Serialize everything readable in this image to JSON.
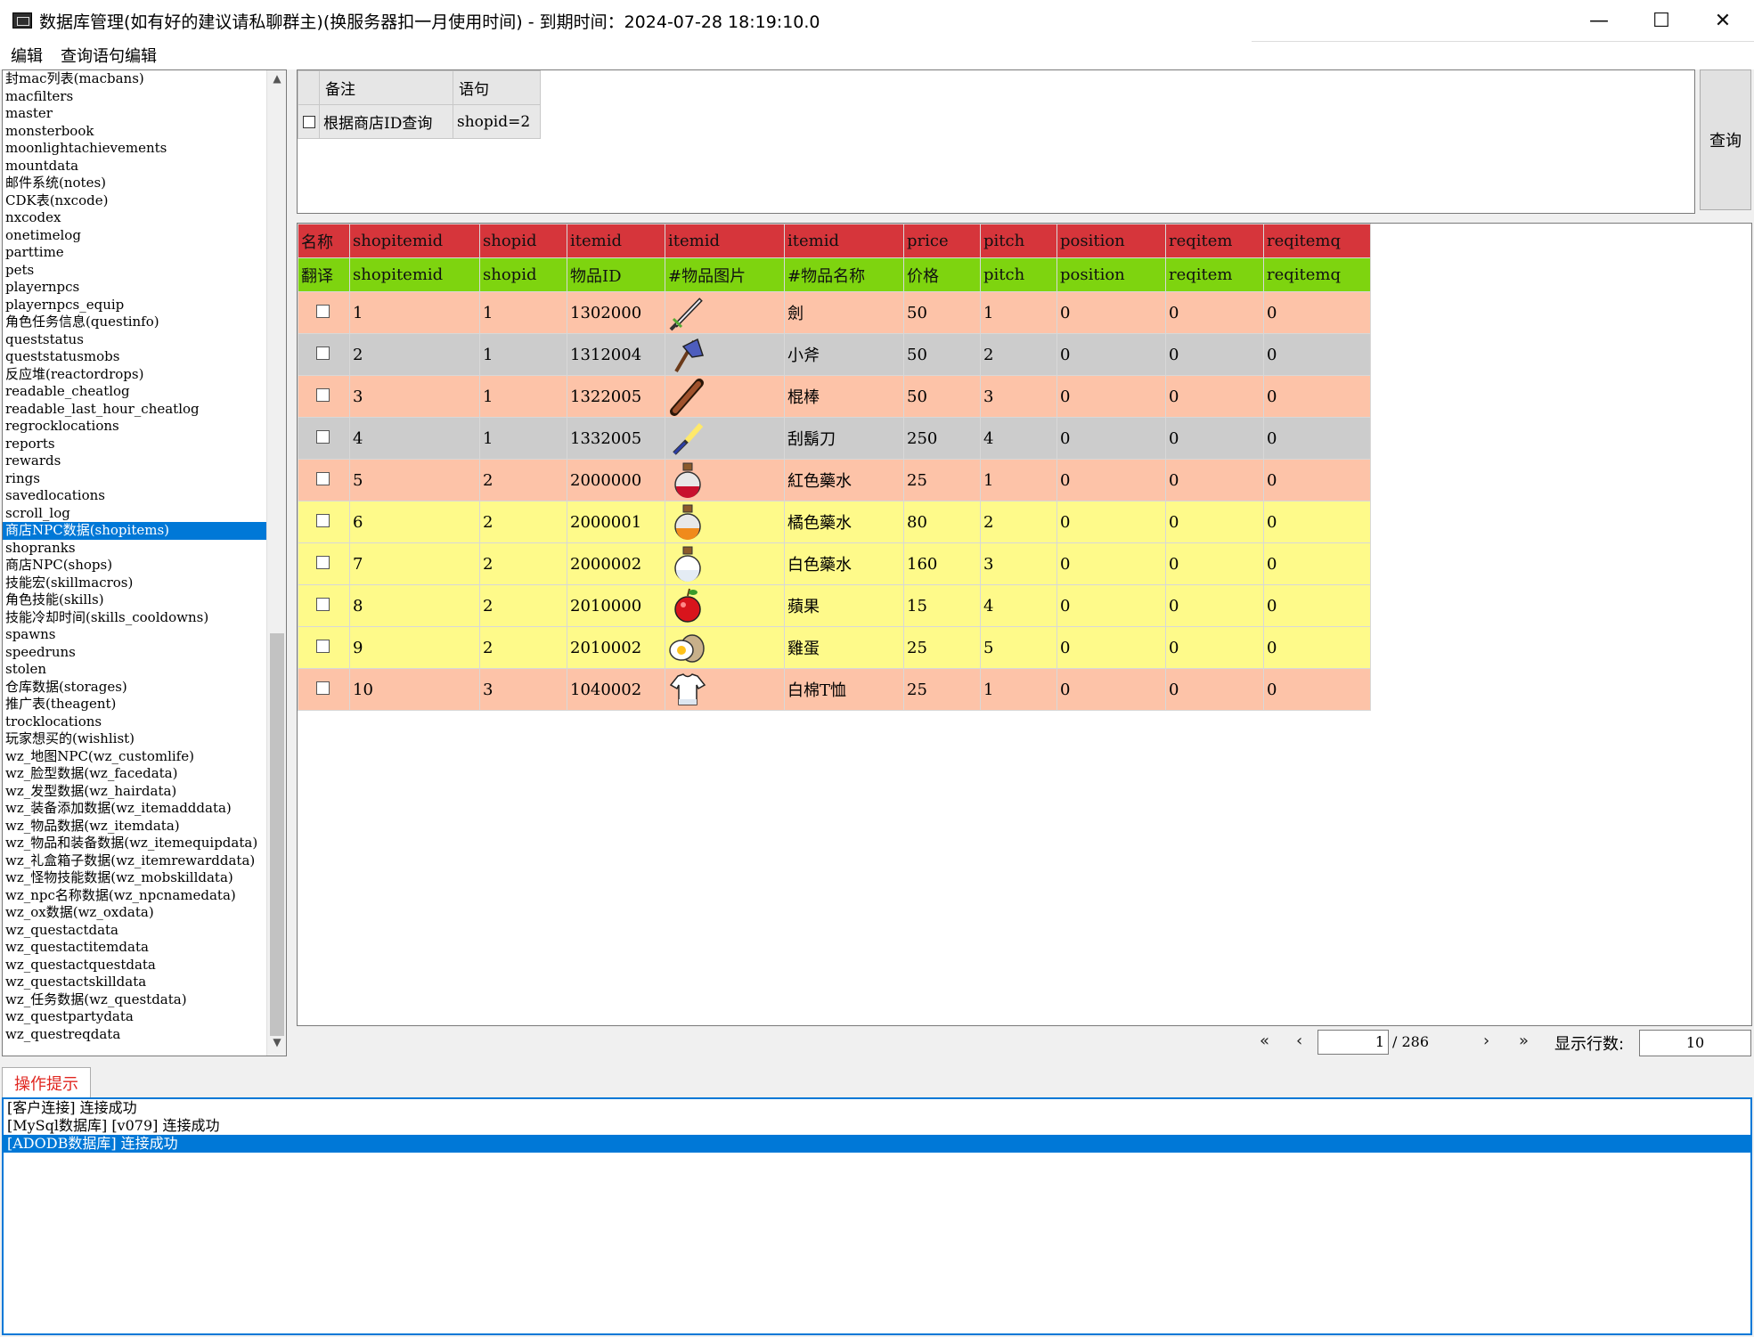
{
  "window": {
    "title": "数据库管理(如有好的建议请私聊群主)(换服务器扣一月使用时间) - 到期时间：2024-07-28 18:19:10.0",
    "minimize_glyph": "—",
    "maximize_glyph": "☐",
    "close_glyph": "✕"
  },
  "menu": [
    "编辑",
    "查询语句编辑"
  ],
  "tables": [
    "封mac列表(macbans)",
    "macfilters",
    "master",
    "monsterbook",
    "moonlightachievements",
    "mountdata",
    "邮件系统(notes)",
    "CDK表(nxcode)",
    "nxcodex",
    "onetimelog",
    "parttime",
    "pets",
    "playernpcs",
    "playernpcs_equip",
    "角色任务信息(questinfo)",
    "queststatus",
    "queststatusmobs",
    "反应堆(reactordrops)",
    "readable_cheatlog",
    "readable_last_hour_cheatlog",
    "regrocklocations",
    "reports",
    "rewards",
    "rings",
    "savedlocations",
    "scroll_log",
    "商店NPC数据(shopitems)",
    "shopranks",
    "商店NPC(shops)",
    "技能宏(skillmacros)",
    "角色技能(skills)",
    "技能冷却时间(skills_cooldowns)",
    "spawns",
    "speedruns",
    "stolen",
    "仓库数据(storages)",
    "推广表(theagent)",
    "trocklocations",
    "玩家想买的(wishlist)",
    "wz_地图NPC(wz_customlife)",
    "wz_脸型数据(wz_facedata)",
    "wz_发型数据(wz_hairdata)",
    "wz_装备添加数据(wz_itemadddata)",
    "wz_物品数据(wz_itemdata)",
    "wz_物品和装备数据(wz_itemequipdata)",
    "wz_礼盒箱子数据(wz_itemrewarddata)",
    "wz_怪物技能数据(wz_mobskilldata)",
    "wz_npc名称数据(wz_npcnamedata)",
    "wz_ox数据(wz_oxdata)",
    "wz_questactdata",
    "wz_questactitemdata",
    "wz_questactquestdata",
    "wz_questactskilldata",
    "wz_任务数据(wz_questdata)",
    "wz_questpartydata",
    "wz_questreqdata"
  ],
  "selected_table": "商店NPC数据(shopitems)",
  "query": {
    "headers": [
      "备注",
      "语句"
    ],
    "rows": [
      {
        "note": "根据商店ID查询",
        "sql": "shopid=2",
        "checked": false
      }
    ],
    "button_label": "查询"
  },
  "grid": {
    "name_row": [
      "名称",
      "shopitemid",
      "shopid",
      "itemid",
      "itemid",
      "itemid",
      "price",
      "pitch",
      "position",
      "reqitem",
      "reqitemq"
    ],
    "trans_row": [
      "翻译",
      "shopitemid",
      "shopid",
      "物品ID",
      "#物品图片",
      "#物品名称",
      "价格",
      "pitch",
      "position",
      "reqitem",
      "reqitemq"
    ],
    "rows": [
      {
        "shopitemid": "1",
        "shopid": "1",
        "itemid": "1302000",
        "icon": "sword-icon",
        "name": "劍",
        "price": "50",
        "pitch": "1",
        "position": "0",
        "reqitem": "0",
        "reqitemq": "0",
        "color": "salmon"
      },
      {
        "shopitemid": "2",
        "shopid": "1",
        "itemid": "1312004",
        "icon": "axe-icon",
        "name": "小斧",
        "price": "50",
        "pitch": "2",
        "position": "0",
        "reqitem": "0",
        "reqitemq": "0",
        "color": "gray"
      },
      {
        "shopitemid": "3",
        "shopid": "1",
        "itemid": "1322005",
        "icon": "club-icon",
        "name": "棍棒",
        "price": "50",
        "pitch": "3",
        "position": "0",
        "reqitem": "0",
        "reqitemq": "0",
        "color": "salmon"
      },
      {
        "shopitemid": "4",
        "shopid": "1",
        "itemid": "1332005",
        "icon": "razor-icon",
        "name": "刮鬍刀",
        "price": "250",
        "pitch": "4",
        "position": "0",
        "reqitem": "0",
        "reqitemq": "0",
        "color": "gray"
      },
      {
        "shopitemid": "5",
        "shopid": "2",
        "itemid": "2000000",
        "icon": "red-potion-icon",
        "name": "紅色藥水",
        "price": "25",
        "pitch": "1",
        "position": "0",
        "reqitem": "0",
        "reqitemq": "0",
        "color": "salmon"
      },
      {
        "shopitemid": "6",
        "shopid": "2",
        "itemid": "2000001",
        "icon": "orange-potion-icon",
        "name": "橘色藥水",
        "price": "80",
        "pitch": "2",
        "position": "0",
        "reqitem": "0",
        "reqitemq": "0",
        "color": "yellow"
      },
      {
        "shopitemid": "7",
        "shopid": "2",
        "itemid": "2000002",
        "icon": "white-potion-icon",
        "name": "白色藥水",
        "price": "160",
        "pitch": "3",
        "position": "0",
        "reqitem": "0",
        "reqitemq": "0",
        "color": "yellow"
      },
      {
        "shopitemid": "8",
        "shopid": "2",
        "itemid": "2010000",
        "icon": "apple-icon",
        "name": "蘋果",
        "price": "15",
        "pitch": "4",
        "position": "0",
        "reqitem": "0",
        "reqitemq": "0",
        "color": "yellow"
      },
      {
        "shopitemid": "9",
        "shopid": "2",
        "itemid": "2010002",
        "icon": "egg-icon",
        "name": "雞蛋",
        "price": "25",
        "pitch": "5",
        "position": "0",
        "reqitem": "0",
        "reqitemq": "0",
        "color": "yellow"
      },
      {
        "shopitemid": "10",
        "shopid": "3",
        "itemid": "1040002",
        "icon": "tshirt-icon",
        "name": "白棉T恤",
        "price": "25",
        "pitch": "1",
        "position": "0",
        "reqitem": "0",
        "reqitemq": "0",
        "color": "salmon"
      }
    ]
  },
  "pager": {
    "first": "«",
    "prev": "‹",
    "next": "›",
    "last": "»",
    "current": "1",
    "total": "/ 286",
    "rows_label": "显示行数:",
    "rows_value": "10"
  },
  "log": {
    "tab_label": "操作提示",
    "lines": [
      "[客户连接] 连接成功",
      "[MySql数据库] [v079] 连接成功",
      "[ADODB数据库] 连接成功"
    ],
    "selected_index": 2
  },
  "colors": {
    "name_header": "#d6353b",
    "trans_header": "#7ed40f",
    "row_salmon": "#fdc3a8",
    "row_gray": "#cccccc",
    "row_yellow": "#fefa8a",
    "selection": "#0078d7",
    "log_tab_text": "#e0261f"
  }
}
